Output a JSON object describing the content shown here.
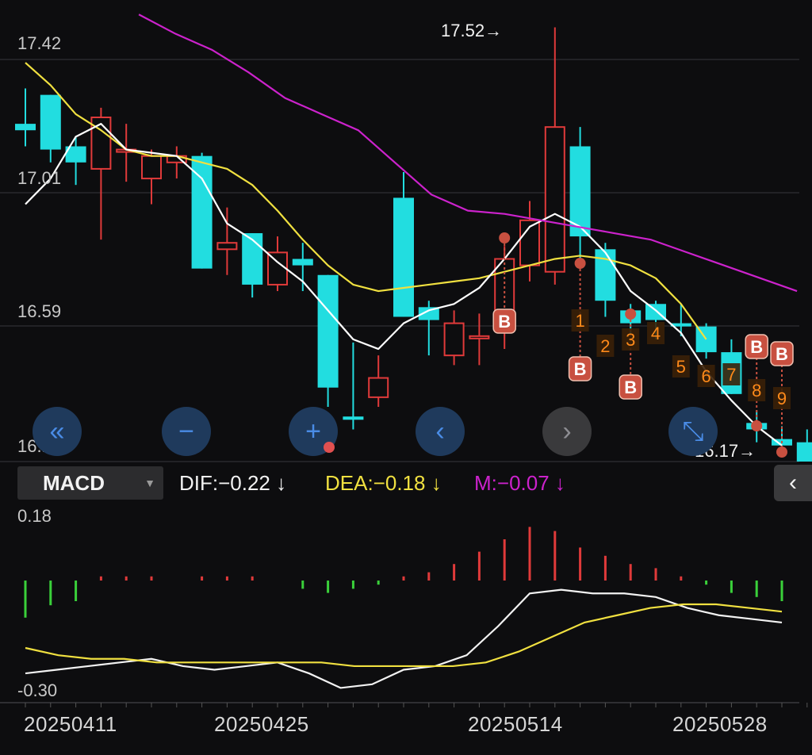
{
  "price_axis": {
    "labels": [
      "17.42",
      "17.01",
      "16.59",
      "16.17"
    ]
  },
  "price_annotations": {
    "high": "17.52→",
    "low": "16.17→"
  },
  "nav_buttons": [
    {
      "name": "scroll-left-fast-button",
      "glyph": "«"
    },
    {
      "name": "zoom-out-button",
      "glyph": "−"
    },
    {
      "name": "zoom-in-button",
      "glyph": "+"
    },
    {
      "name": "scroll-left-button",
      "glyph": "‹"
    },
    {
      "name": "scroll-right-button",
      "glyph": "›"
    },
    {
      "name": "expand-button",
      "glyph": "⤡"
    }
  ],
  "indicator": {
    "selected": "MACD",
    "dif": "DIF:−0.22 ↓",
    "dea": "DEA:−0.18 ↓",
    "m": "M:−0.07 ↓"
  },
  "macd_axis": {
    "top": "0.18",
    "bottom": "-0.30"
  },
  "x_axis": {
    "labels": [
      "20250411",
      "20250425",
      "20250514",
      "20250528"
    ]
  },
  "colors": {
    "up": "#e03a3a",
    "down": "#22dde0",
    "ma5": "#ffffff",
    "ma10": "#f0e040",
    "ma20": "#cc22cc",
    "signal_b": "#c85040",
    "seq": "#ff8a1a"
  },
  "chart_data": {
    "type": "candlestick",
    "ylim": [
      16.17,
      17.52
    ],
    "candles": [
      {
        "o": 17.22,
        "h": 17.33,
        "l": 17.15,
        "c": 17.2
      },
      {
        "o": 17.31,
        "h": 17.31,
        "l": 17.1,
        "c": 17.14
      },
      {
        "o": 17.15,
        "h": 17.18,
        "l": 17.03,
        "c": 17.1
      },
      {
        "o": 17.08,
        "h": 17.27,
        "l": 16.86,
        "c": 17.24
      },
      {
        "o": 17.14,
        "h": 17.22,
        "l": 17.04,
        "c": 17.14
      },
      {
        "o": 17.05,
        "h": 17.14,
        "l": 16.97,
        "c": 17.12
      },
      {
        "o": 17.1,
        "h": 17.15,
        "l": 17.05,
        "c": 17.12
      },
      {
        "o": 17.12,
        "h": 17.13,
        "l": 16.77,
        "c": 16.77
      },
      {
        "o": 16.83,
        "h": 16.96,
        "l": 16.75,
        "c": 16.85
      },
      {
        "o": 16.88,
        "h": 16.88,
        "l": 16.68,
        "c": 16.72
      },
      {
        "o": 16.72,
        "h": 16.87,
        "l": 16.7,
        "c": 16.82
      },
      {
        "o": 16.8,
        "h": 16.85,
        "l": 16.7,
        "c": 16.78
      },
      {
        "o": 16.75,
        "h": 16.75,
        "l": 16.34,
        "c": 16.4
      },
      {
        "o": 16.31,
        "h": 16.54,
        "l": 16.27,
        "c": 16.3
      },
      {
        "o": 16.37,
        "h": 16.5,
        "l": 16.34,
        "c": 16.43
      },
      {
        "o": 16.99,
        "h": 17.07,
        "l": 16.62,
        "c": 16.62
      },
      {
        "o": 16.65,
        "h": 16.67,
        "l": 16.5,
        "c": 16.61
      },
      {
        "o": 16.5,
        "h": 16.64,
        "l": 16.47,
        "c": 16.6
      },
      {
        "o": 16.56,
        "h": 16.63,
        "l": 16.47,
        "c": 16.56
      },
      {
        "o": 16.62,
        "h": 16.84,
        "l": 16.52,
        "c": 16.8
      },
      {
        "o": 16.78,
        "h": 16.98,
        "l": 16.73,
        "c": 16.92
      },
      {
        "o": 16.76,
        "h": 17.52,
        "l": 16.72,
        "c": 17.21
      },
      {
        "o": 17.15,
        "h": 17.21,
        "l": 16.77,
        "c": 16.87
      },
      {
        "o": 16.83,
        "h": 16.85,
        "l": 16.62,
        "c": 16.67
      },
      {
        "o": 16.64,
        "h": 16.66,
        "l": 16.56,
        "c": 16.6
      },
      {
        "o": 16.66,
        "h": 16.67,
        "l": 16.55,
        "c": 16.61
      },
      {
        "o": 16.6,
        "h": 16.66,
        "l": 16.56,
        "c": 16.59
      },
      {
        "o": 16.59,
        "h": 16.6,
        "l": 16.49,
        "c": 16.51
      },
      {
        "o": 16.51,
        "h": 16.55,
        "l": 16.38,
        "c": 16.38
      },
      {
        "o": 16.29,
        "h": 16.33,
        "l": 16.23,
        "c": 16.27
      },
      {
        "o": 16.24,
        "h": 16.28,
        "l": 16.19,
        "c": 16.22
      },
      {
        "o": 16.23,
        "h": 16.27,
        "l": 16.17,
        "c": 16.17
      }
    ],
    "ma5": [
      16.97,
      17.05,
      17.18,
      17.22,
      17.14,
      17.13,
      17.12,
      17.05,
      16.91,
      16.86,
      16.79,
      16.73,
      16.64,
      16.55,
      16.52,
      16.6,
      16.64,
      16.66,
      16.71,
      16.8,
      16.9,
      16.94,
      16.9,
      16.82,
      16.7,
      16.64,
      16.57,
      16.45,
      16.36,
      16.28,
      16.22
    ],
    "ma10": [
      17.41,
      17.34,
      17.25,
      17.2,
      17.14,
      17.12,
      17.12,
      17.1,
      17.08,
      17.03,
      16.95,
      16.86,
      16.78,
      16.72,
      16.7,
      16.71,
      16.72,
      16.73,
      16.74,
      16.76,
      16.78,
      16.8,
      16.81,
      16.8,
      16.78,
      16.74,
      16.66,
      16.55
    ],
    "ma20": [
      17.56,
      17.5,
      17.45,
      17.38,
      17.3,
      17.25,
      17.2,
      17.1,
      17.0,
      16.95,
      16.94,
      16.92,
      16.9,
      16.88,
      16.86,
      16.82,
      16.78,
      16.74,
      16.7
    ],
    "macd_ylim": [
      -0.3,
      0.18
    ],
    "macd_bars": [
      -0.09,
      -0.06,
      -0.05,
      0.01,
      0.01,
      0.01,
      0.0,
      0.01,
      0.01,
      0.01,
      0.0,
      -0.02,
      -0.03,
      -0.02,
      -0.01,
      0.01,
      0.02,
      0.04,
      0.07,
      0.1,
      0.13,
      0.12,
      0.08,
      0.06,
      0.04,
      0.03,
      0.01,
      -0.01,
      -0.03,
      -0.04,
      -0.05
    ],
    "dif": [
      -0.25,
      -0.24,
      -0.23,
      -0.22,
      -0.21,
      -0.23,
      -0.24,
      -0.23,
      -0.22,
      -0.25,
      -0.29,
      -0.28,
      -0.24,
      -0.23,
      -0.2,
      -0.12,
      -0.03,
      -0.02,
      -0.03,
      -0.03,
      -0.04,
      -0.07,
      -0.09,
      -0.1,
      -0.11
    ],
    "dea": [
      -0.18,
      -0.2,
      -0.21,
      -0.21,
      -0.22,
      -0.22,
      -0.22,
      -0.22,
      -0.22,
      -0.22,
      -0.23,
      -0.23,
      -0.23,
      -0.23,
      -0.22,
      -0.19,
      -0.15,
      -0.11,
      -0.09,
      -0.07,
      -0.06,
      -0.06,
      -0.07,
      -0.08
    ],
    "signals": [
      {
        "text": "B",
        "i": 19
      },
      {
        "text": "B",
        "i": 22
      },
      {
        "text": "B",
        "i": 24
      },
      {
        "text": "B",
        "i": 29
      },
      {
        "text": "B",
        "i": 30
      }
    ],
    "sequence": [
      {
        "text": "1",
        "i": 22
      },
      {
        "text": "2",
        "i": 23
      },
      {
        "text": "3",
        "i": 24
      },
      {
        "text": "4",
        "i": 25
      },
      {
        "text": "5",
        "i": 26
      },
      {
        "text": "6",
        "i": 27
      },
      {
        "text": "7",
        "i": 28
      },
      {
        "text": "8",
        "i": 29
      },
      {
        "text": "9",
        "i": 30
      }
    ]
  }
}
